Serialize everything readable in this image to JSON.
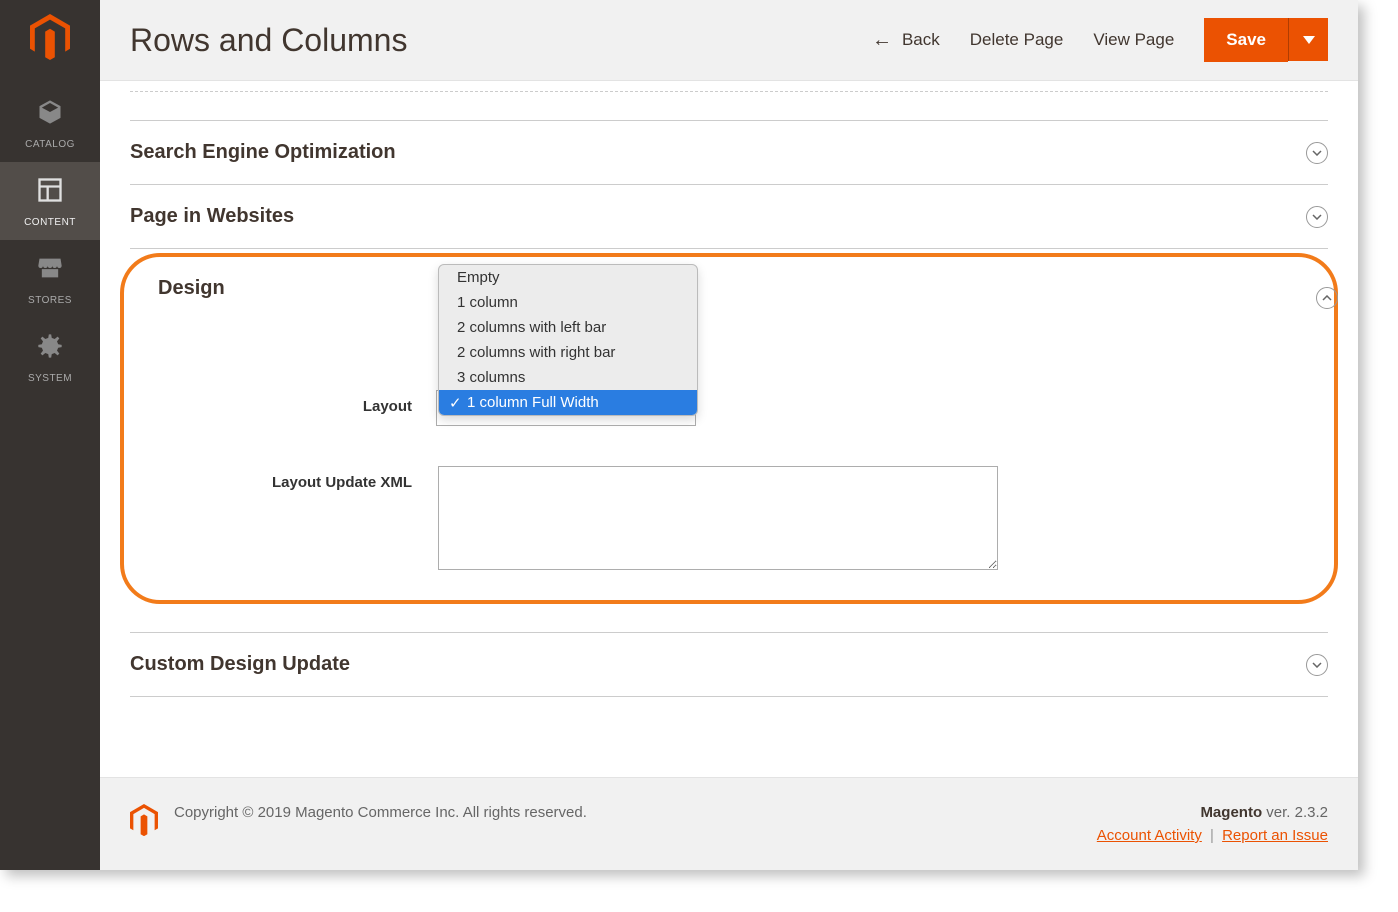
{
  "header": {
    "title": "Rows and Columns",
    "back": "Back",
    "delete": "Delete Page",
    "view": "View Page",
    "save": "Save"
  },
  "sidebar": {
    "items": [
      {
        "label": "CATALOG"
      },
      {
        "label": "CONTENT"
      },
      {
        "label": "STORES"
      },
      {
        "label": "SYSTEM"
      }
    ]
  },
  "sections": {
    "seo": "Search Engine Optimization",
    "pages": "Page in Websites",
    "design": "Design",
    "custom": "Custom Design Update"
  },
  "design": {
    "layout_label": "Layout",
    "xml_label": "Layout Update XML",
    "options": [
      "Empty",
      "1 column",
      "2 columns with left bar",
      "2 columns with right bar",
      "3 columns",
      "1 column Full Width"
    ],
    "selected_index": 5,
    "xml_value": ""
  },
  "footer": {
    "copyright": "Copyright © 2019 Magento Commerce Inc. All rights reserved.",
    "product": "Magento",
    "ver_label": " ver. ",
    "version": "2.3.2",
    "activity": "Account Activity",
    "report": "Report an Issue"
  }
}
